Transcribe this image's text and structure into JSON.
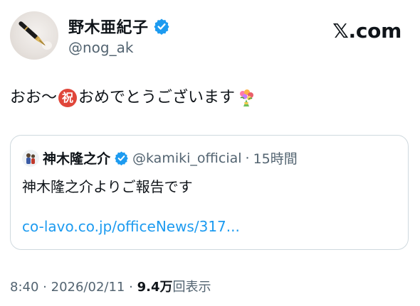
{
  "author": {
    "display_name": "野木亜紀子",
    "handle": "@nog_ak",
    "verified_color": "#1d9bf0"
  },
  "brand": {
    "logo_text": "𝕏.com"
  },
  "tweet": {
    "text_before": "おお〜",
    "emoji_iwai": "祝",
    "text_after": "おめでとうございます",
    "emoji_bouquet": "bouquet-icon"
  },
  "quote": {
    "display_name": "神木隆之介",
    "handle": "@kamiki_official",
    "separator": "·",
    "time_ago": "15時間",
    "body": "神木隆之介よりご報告です",
    "link_text": "co-lavo.co.jp/officeNews/317..."
  },
  "meta": {
    "time": "8:40",
    "separator": "·",
    "date": "2026/02/11",
    "separator2": "·",
    "views_count": "9.4万",
    "views_label": "回表示"
  },
  "colors": {
    "accent": "#1d9bf0",
    "text_primary": "#0f1419",
    "text_secondary": "#536471",
    "border": "#cfd9de"
  }
}
